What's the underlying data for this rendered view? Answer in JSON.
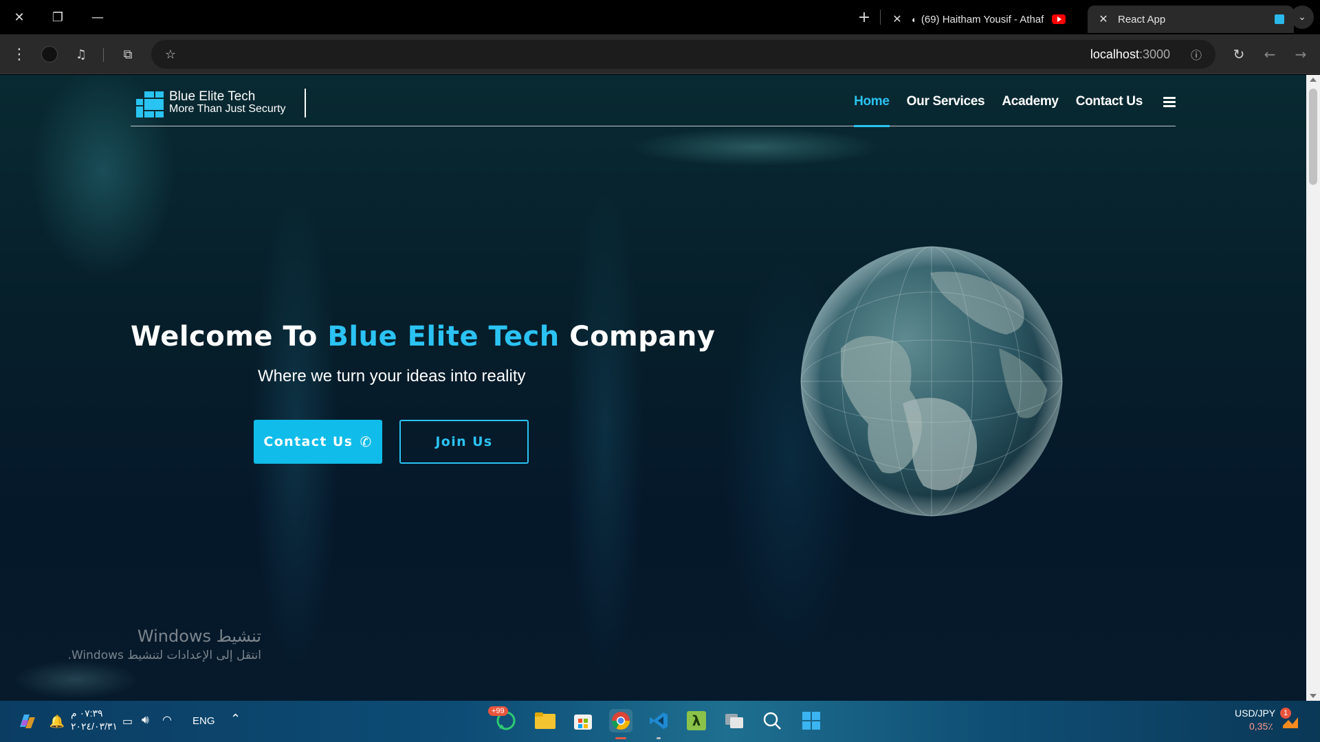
{
  "browser": {
    "tabs": [
      {
        "title": "(69) Haitham Yousif - Athaf",
        "site": "youtube"
      },
      {
        "title": "React App",
        "active": true
      }
    ],
    "url_host": "localhost",
    "url_port": ":3000"
  },
  "site": {
    "brand_name": "Blue Elite Tech",
    "brand_tagline": "More Than Just Securty",
    "nav": [
      {
        "label": "Home",
        "active": true
      },
      {
        "label": "Our Services"
      },
      {
        "label": "Academy"
      },
      {
        "label": "Contact Us"
      }
    ],
    "hero": {
      "title_prefix": "Welcome To ",
      "title_highlight": "Blue Elite Tech",
      "title_suffix": " Company",
      "subtitle": "Where we turn your ideas into reality",
      "primary_button": "Contact Us",
      "secondary_button": "Join Us"
    },
    "accent_color": "#2bc3f3"
  },
  "windows_activation": {
    "title": "تنشيط Windows",
    "message": "انتقل إلى الإعدادات لتنشيط Windows."
  },
  "taskbar": {
    "time": "٠٧:٣٩ م",
    "date": "٢٠٢٤/٠٣/٣١",
    "language": "ENG",
    "whatsapp_badge": "+99",
    "ticker_name": "USD/JPY",
    "ticker_change": "0,35٪",
    "notification_count": "1"
  }
}
